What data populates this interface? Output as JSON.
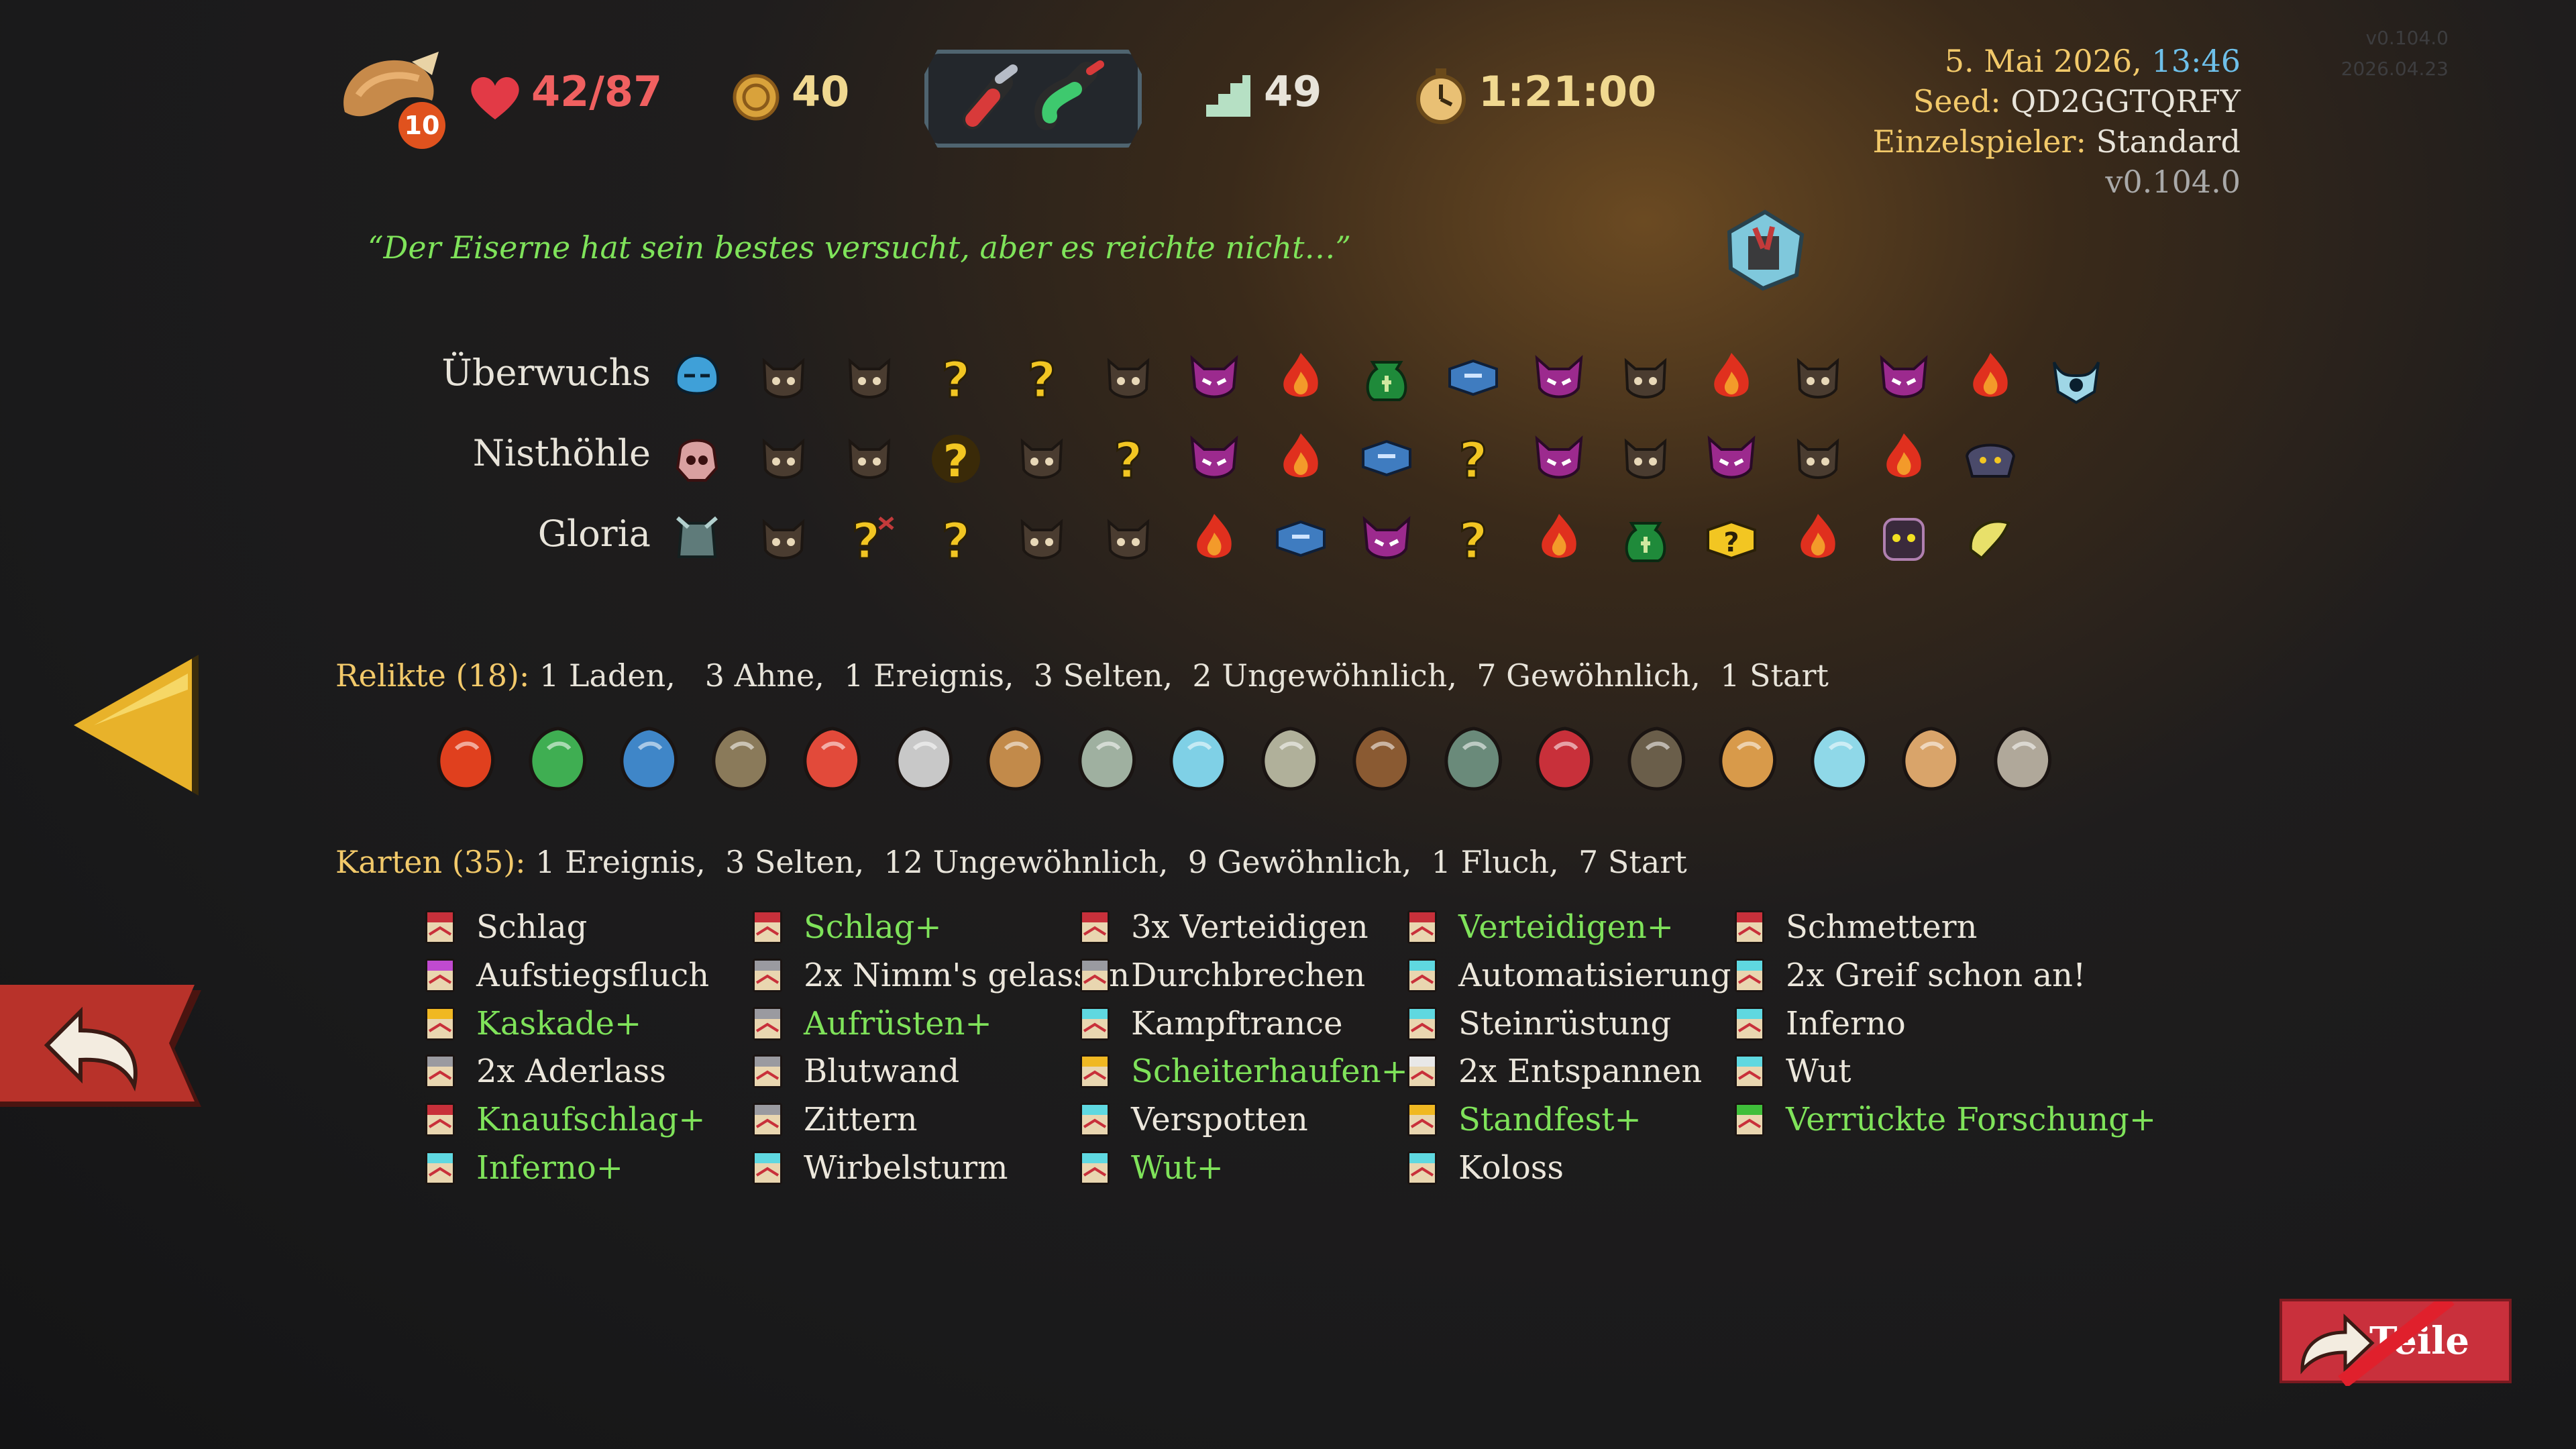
{
  "top_bar": {
    "ascension": "10",
    "hp": "42/87",
    "gold": "40",
    "floor": "49",
    "time": "1:21:00"
  },
  "run_info": {
    "date": "5. Mai 2026,",
    "clock": "13:46",
    "seed_label": "Seed:",
    "seed_value": "QD2GGTQRFY",
    "mode_label": "Einzelspieler:",
    "mode_value": "Standard",
    "version": "v0.104.0",
    "faint_version": "v0.104.0",
    "faint_date": "2026.04.23"
  },
  "quote": "“Der Eiserne hat sein bestes versucht, aber es reichte nicht…”",
  "acts": [
    {
      "name": "Überwuchs",
      "nodes": [
        "boss-slime",
        "monster",
        "monster",
        "unknown",
        "unknown",
        "monster",
        "elite",
        "rest",
        "treasure",
        "chest",
        "elite",
        "monster",
        "rest",
        "monster",
        "elite",
        "rest",
        "boss-eye"
      ]
    },
    {
      "name": "Nisthöhle",
      "nodes": [
        "boss-skull",
        "monster",
        "monster",
        "unknown-bold",
        "monster",
        "unknown",
        "elite",
        "rest",
        "chest",
        "unknown",
        "elite",
        "monster",
        "elite",
        "monster",
        "rest",
        "boss-beast"
      ]
    },
    {
      "name": "Gloria",
      "nodes": [
        "boss-knight",
        "monster",
        "unknown-crossed",
        "unknown",
        "monster",
        "monster",
        "rest",
        "chest",
        "elite",
        "unknown",
        "rest",
        "treasure",
        "unknown-box",
        "rest",
        "boss-ghost",
        "boss-worm"
      ]
    }
  ],
  "relics": {
    "title": "Relikte (18):",
    "summary": "1 Laden,   3 Ahne,  1 Ereignis,  3 Selten,  2 Ungewöhnlich,  7 Gewöhnlich,  1 Start",
    "icons": [
      "burning-blood-icon",
      "chain-icon",
      "anchor-icon",
      "mushroom-icon",
      "vajra-icon",
      "scythe-icon",
      "horn-icon",
      "chandelier-icon",
      "crystal-icon",
      "newton-cradle-icon",
      "planks-icon",
      "teapot-icon",
      "scarf-icon",
      "tile-icon",
      "leaf-icon",
      "prism-icon",
      "cookie-icon",
      "candelabra-icon"
    ]
  },
  "cards": {
    "title": "Karten (35):",
    "summary": "1 Ereignis,  3 Selten,  12 Ungewöhnlich,  9 Gewöhnlich,  1 Fluch,  7 Start",
    "columns": [
      [
        {
          "label": "Schlag",
          "upgraded": false,
          "color": "red"
        },
        {
          "label": "Aufstiegsfluch",
          "upgraded": false,
          "color": "purple"
        },
        {
          "label": "Kaskade+",
          "upgraded": true,
          "color": "gold"
        },
        {
          "label": "2x Aderlass",
          "upgraded": false,
          "color": "grey"
        },
        {
          "label": "Knaufschlag+",
          "upgraded": true,
          "color": "red"
        },
        {
          "label": "Inferno+",
          "upgraded": true,
          "color": "cyan"
        }
      ],
      [
        {
          "label": "Schlag+",
          "upgraded": true,
          "color": "red"
        },
        {
          "label": "2x Nimm's gelassen",
          "upgraded": false,
          "color": "grey"
        },
        {
          "label": "Aufrüsten+",
          "upgraded": true,
          "color": "grey"
        },
        {
          "label": "Blutwand",
          "upgraded": false,
          "color": "grey"
        },
        {
          "label": "Zittern",
          "upgraded": false,
          "color": "grey"
        },
        {
          "label": "Wirbelsturm",
          "upgraded": false,
          "color": "cyan"
        }
      ],
      [
        {
          "label": "3x Verteidigen",
          "upgraded": false,
          "color": "red"
        },
        {
          "label": "Durchbrechen",
          "upgraded": false,
          "color": "grey"
        },
        {
          "label": "Kampftrance",
          "upgraded": false,
          "color": "cyan"
        },
        {
          "label": "Scheiterhaufen+",
          "upgraded": true,
          "color": "gold"
        },
        {
          "label": "Verspotten",
          "upgraded": false,
          "color": "cyan"
        },
        {
          "label": "Wut+",
          "upgraded": true,
          "color": "cyan"
        }
      ],
      [
        {
          "label": "Verteidigen+",
          "upgraded": true,
          "color": "red"
        },
        {
          "label": "Automatisierung",
          "upgraded": false,
          "color": "cyan"
        },
        {
          "label": "Steinrüstung",
          "upgraded": false,
          "color": "cyan"
        },
        {
          "label": "2x Entspannen",
          "upgraded": false,
          "color": "white"
        },
        {
          "label": "Standfest+",
          "upgraded": true,
          "color": "gold"
        },
        {
          "label": "Koloss",
          "upgraded": false,
          "color": "cyan"
        }
      ],
      [
        {
          "label": "Schmettern",
          "upgraded": false,
          "color": "red"
        },
        {
          "label": "2x Greif schon an!",
          "upgraded": false,
          "color": "cyan"
        },
        {
          "label": "Inferno",
          "upgraded": false,
          "color": "cyan"
        },
        {
          "label": "Wut",
          "upgraded": false,
          "color": "cyan"
        },
        {
          "label": "Verrückte Forschung+",
          "upgraded": true,
          "color": "green"
        }
      ]
    ]
  },
  "share_button_label": "Teile"
}
